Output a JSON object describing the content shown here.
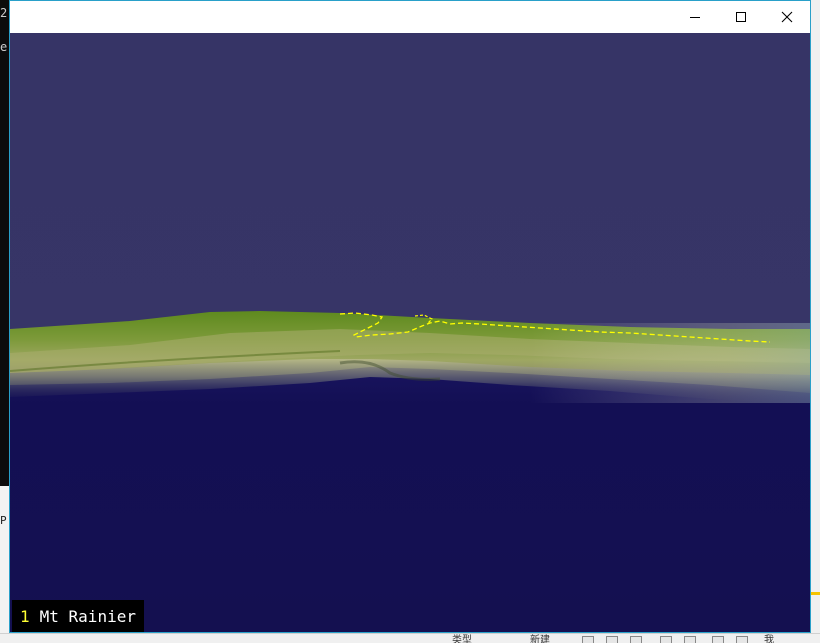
{
  "console": {
    "top_char": "2",
    "second_char": "e",
    "lower_char": "P"
  },
  "window": {
    "controls": {
      "minimize": "minimize-icon",
      "maximize": "maximize-icon",
      "close": "close-icon"
    }
  },
  "scene": {
    "sky_color": "#363466",
    "water_color": "#120f52",
    "terrain_color": "#6f8f2a",
    "trail_color": "#ffff00",
    "label": {
      "number": "1",
      "name": "Mt Rainier"
    }
  },
  "taskbar": {
    "items": [
      "类型",
      "新建",
      "我"
    ]
  }
}
